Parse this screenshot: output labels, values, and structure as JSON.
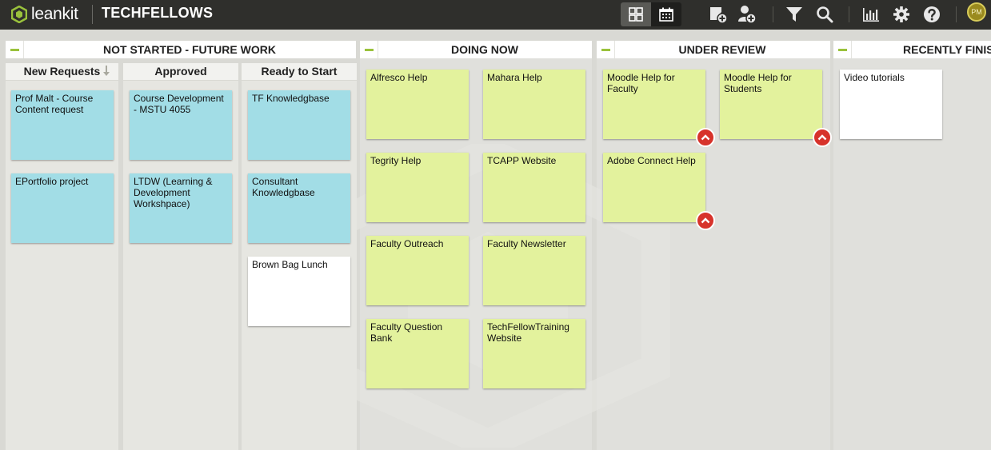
{
  "app": {
    "logo_text": "leankit",
    "board_title": "TECHFELLOWS",
    "avatar_initials": "PM"
  },
  "toolbar_icons": [
    "board-view-icon",
    "calendar-icon",
    "add-card-icon",
    "add-user-icon",
    "filter-icon",
    "search-icon",
    "analytics-icon",
    "gear-icon",
    "help-icon"
  ],
  "lanes": [
    {
      "title": "NOT STARTED - FUTURE WORK",
      "sublanes": [
        {
          "title": "New Requests",
          "cards": [
            {
              "text": "Prof Malt - Course Content request",
              "color": "#a2dde6"
            },
            {
              "text": "EPortfolio project",
              "color": "#a2dde6"
            }
          ]
        },
        {
          "title": "Approved",
          "cards": [
            {
              "text": "Course Development - MSTU 4055",
              "color": "#a2dde6"
            },
            {
              "text": "LTDW (Learning & Development Workshpace)",
              "color": "#a2dde6"
            }
          ]
        },
        {
          "title": "Ready to Start",
          "cards": [
            {
              "text": "TF Knowledgbase",
              "color": "#a2dde6"
            },
            {
              "text": "Consultant Knowledgbase",
              "color": "#a2dde6"
            },
            {
              "text": "Brown Bag Lunch",
              "color": "#ffffff"
            }
          ]
        }
      ]
    },
    {
      "title": "DOING NOW",
      "cards": [
        {
          "text": "Alfresco Help",
          "color": "#e3f29d"
        },
        {
          "text": "Mahara Help",
          "color": "#e3f29d"
        },
        {
          "text": "Tegrity Help",
          "color": "#e3f29d"
        },
        {
          "text": "TCAPP Website",
          "color": "#e3f29d"
        },
        {
          "text": "Faculty Outreach",
          "color": "#e3f29d"
        },
        {
          "text": "Faculty Newsletter",
          "color": "#e3f29d"
        },
        {
          "text": "Faculty Question Bank",
          "color": "#e3f29d"
        },
        {
          "text": "TechFellowTraining Website",
          "color": "#e3f29d"
        }
      ]
    },
    {
      "title": "UNDER REVIEW",
      "cards": [
        {
          "text": "Moodle Help for Faculty",
          "color": "#e3f29d",
          "blocked": true
        },
        {
          "text": "Moodle Help for Students",
          "color": "#e3f29d",
          "blocked": true
        },
        {
          "text": "Adobe Connect Help",
          "color": "#e3f29d",
          "blocked": true
        }
      ]
    },
    {
      "title": "RECENTLY FINISHED",
      "cards": [
        {
          "text": "Video tutorials",
          "color": "#ffffff"
        }
      ]
    }
  ],
  "colors": {
    "topbar": "#2f2f2c",
    "accent_green": "#9ac23c",
    "blocker_red": "#d7332b"
  }
}
